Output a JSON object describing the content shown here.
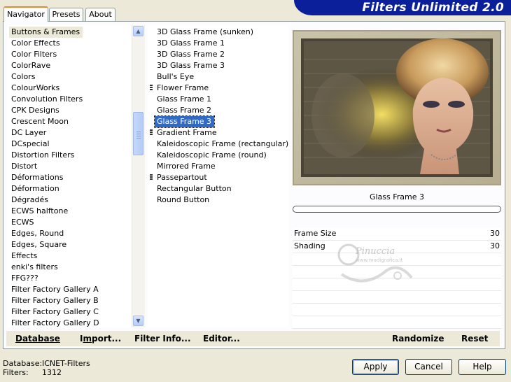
{
  "app_title": "Filters Unlimited 2.0",
  "tabs": [
    {
      "label": "Navigator",
      "active": true
    },
    {
      "label": "Presets",
      "active": false
    },
    {
      "label": "About",
      "active": false
    }
  ],
  "categories": [
    "Buttons & Frames",
    "Color Effects",
    "Color Filters",
    "ColorRave",
    "Colors",
    "ColourWorks",
    "Convolution Filters",
    "CPK Designs",
    "Crescent Moon",
    "DC Layer",
    "DCspecial",
    "Distortion Filters",
    "Distort",
    "Déformations",
    "Déformation",
    "Dégradés",
    "ECWS halftone",
    "ECWS",
    "Edges, Round",
    "Edges, Square",
    "Effects",
    "enki's filters",
    "FFG???",
    "Filter Factory Gallery A",
    "Filter Factory Gallery B",
    "Filter Factory Gallery C",
    "Filter Factory Gallery D"
  ],
  "selected_category": "Buttons & Frames",
  "filters": [
    {
      "label": "3D Glass Frame (sunken)",
      "submenu": false
    },
    {
      "label": "3D Glass Frame 1",
      "submenu": false
    },
    {
      "label": "3D Glass Frame 2",
      "submenu": false
    },
    {
      "label": "3D Glass Frame 3",
      "submenu": false
    },
    {
      "label": "Bull's Eye",
      "submenu": false
    },
    {
      "label": "Flower Frame",
      "submenu": true
    },
    {
      "label": "Glass Frame 1",
      "submenu": false
    },
    {
      "label": "Glass Frame 2",
      "submenu": false
    },
    {
      "label": "Glass Frame 3",
      "submenu": false
    },
    {
      "label": "Gradient Frame",
      "submenu": true
    },
    {
      "label": "Kaleidoscopic Frame (rectangular)",
      "submenu": false
    },
    {
      "label": "Kaleidoscopic Frame (round)",
      "submenu": false
    },
    {
      "label": "Mirrored Frame",
      "submenu": false
    },
    {
      "label": "Passepartout",
      "submenu": true
    },
    {
      "label": "Rectangular Button",
      "submenu": false
    },
    {
      "label": "Round Button",
      "submenu": false
    }
  ],
  "selected_filter": "Glass Frame 3",
  "preview_filter_name": "Glass Frame 3",
  "params": [
    {
      "label": "Frame Size",
      "value": "30"
    },
    {
      "label": "Shading",
      "value": "30"
    }
  ],
  "watermark": "Pinuccia",
  "watermark_sub": "www.madigrafica.it",
  "bottom_actions": {
    "database": "Database",
    "import_prefix": "I",
    "import_underline": "m",
    "import_suffix": "port...",
    "filter_info": "Filter Info...",
    "editor": "Editor...",
    "randomize": "Randomize",
    "reset": "Reset"
  },
  "status": {
    "database_label": "Database:",
    "database_value": "ICNET-Filters",
    "filters_label": "Filters:",
    "filters_value": "1312"
  },
  "dialog_buttons": {
    "apply": "Apply",
    "cancel": "Cancel",
    "help": "Help"
  },
  "colors": {
    "banner": "#0b1f9b",
    "selection": "#316ac5",
    "tab_highlight": "#e68b2c"
  }
}
